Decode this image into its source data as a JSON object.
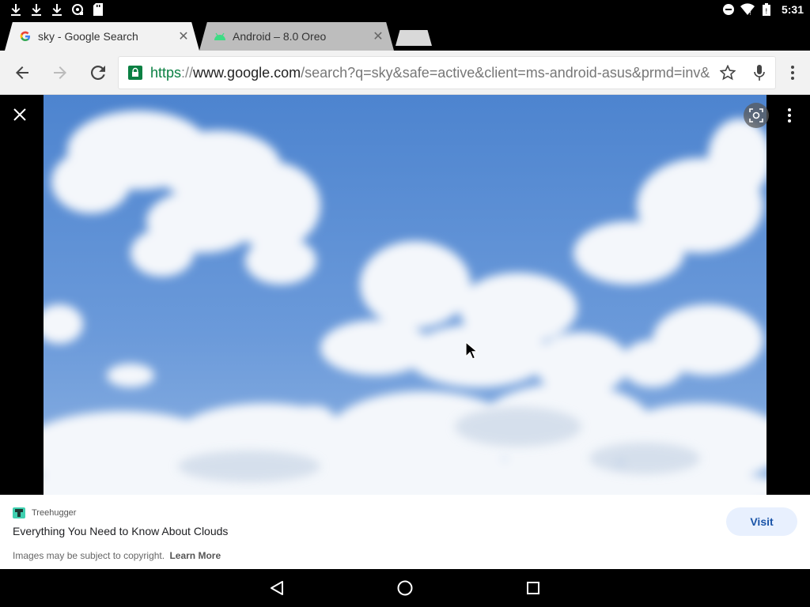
{
  "statusbar": {
    "time": "5:31"
  },
  "tabs": [
    {
      "title": "sky - Google Search",
      "favicon": "google-g-icon"
    },
    {
      "title": "Android – 8.0 Oreo",
      "favicon": "android-icon"
    }
  ],
  "toolbar": {
    "url_scheme": "https",
    "url_sep": "://",
    "url_host": "www.google.com",
    "url_path": "/search?q=sky&safe=active&client=ms-android-asus&prmd=inv&"
  },
  "card": {
    "source": "Treehugger",
    "title": "Everything You Need to Know About Clouds",
    "copyright": "Images may be subject to copyright.",
    "learn_more": "Learn More",
    "visit_label": "Visit"
  },
  "colors": {
    "sky": "#5b8fd1",
    "secure_green": "#0b8043",
    "visit_text": "#1a54a8"
  }
}
